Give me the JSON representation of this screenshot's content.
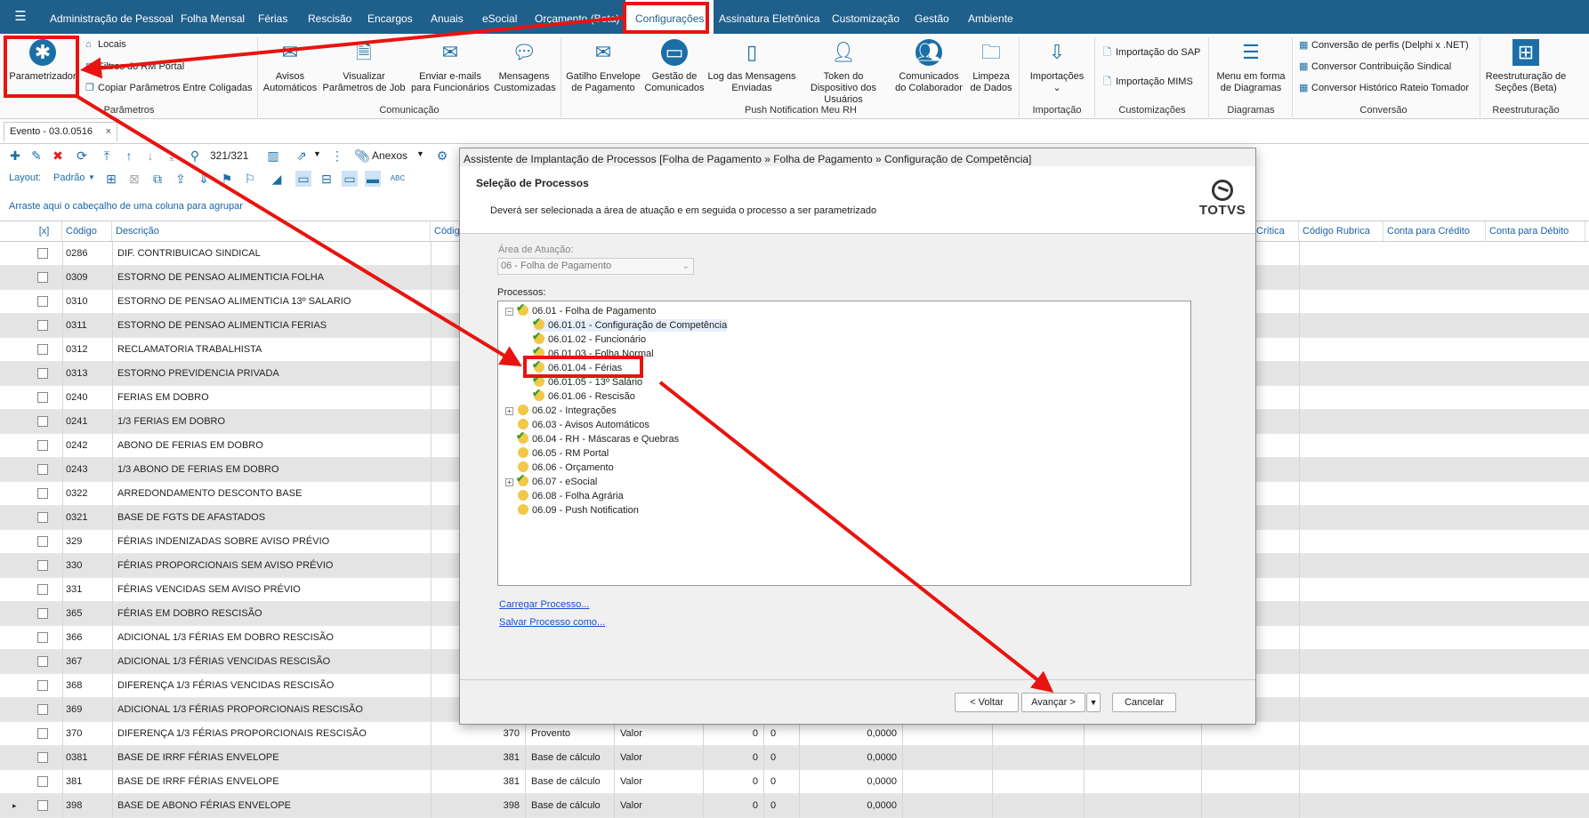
{
  "menubar": {
    "items": [
      "Administração de Pessoal",
      "Folha Mensal",
      "Férias",
      "Rescisão",
      "Encargos",
      "Anuais",
      "eSocial",
      "Orçamento (Beta)",
      "Configurações",
      "Assinatura Eletrônica",
      "Customização",
      "Gestão",
      "Ambiente"
    ],
    "active": "Configurações"
  },
  "ribbon": {
    "parametrizador": "Parametrizador",
    "locais": "Locais",
    "filtros_rm_portal": "Filtros do RM Portal",
    "copiar_parametros": "Copiar Parâmetros Entre Coligadas",
    "group_parametros": "Parâmetros",
    "comunicacao": [
      "Avisos Automáticos",
      "Visualizar Parâmetros de Job",
      "Enviar e-mails para Funcionários",
      "Mensagens Customizadas"
    ],
    "group_comunicacao": "Comunicação",
    "push": [
      "Gatilho Envelope de Pagamento",
      "Gestão de Comunicados",
      "Log das Mensagens Enviadas",
      "Token do Dispositivo dos Usuários",
      "Comunicados do Colaborador",
      "Limpeza de Dados"
    ],
    "group_push": "Push Notification Meu RH",
    "importacoes": "Importações",
    "group_importacao": "Importação",
    "import_sap": "Importação do SAP",
    "import_mims": "Importação MIMS",
    "group_customizacoes": "Customizações",
    "menu_diagramas": "Menu em forma de Diagramas",
    "group_diagramas": "Diagramas",
    "conv_perfis": "Conversão de perfis (Delphi x .NET)",
    "conv_sindical": "Conversor Contribuição Sindical",
    "conv_rateio": "Conversor Histórico Rateio Tomador",
    "group_conversao": "Conversão",
    "reestruturacao": "Reestruturação de Seções (Beta)",
    "group_reestruturacao": "Reestruturação"
  },
  "doctab": {
    "label": "Evento - 03.0.0516",
    "close": "×"
  },
  "toolbar": {
    "count": "321/321",
    "anexos": "Anexos",
    "layout_label": "Layout:",
    "layout_value": "Padrão",
    "group_hint": "Arraste aqui o cabeçalho de uma coluna para agrupar"
  },
  "grid": {
    "headers": {
      "sel": "[x]",
      "codigo": "Código",
      "descricao": "Descrição",
      "codigo2": "Códig",
      "critica": "Crítica",
      "codigo_rubrica": "Código Rubrica",
      "conta_credito": "Conta para Crédito",
      "conta_debito": "Conta para Débito",
      "extra": "C"
    },
    "rows": [
      {
        "codigo": "0286",
        "descricao": "DIF. CONTRIBUICAO SINDICAL"
      },
      {
        "codigo": "0309",
        "descricao": "ESTORNO DE PENSAO ALIMENTICIA FOLHA"
      },
      {
        "codigo": "0310",
        "descricao": "ESTORNO DE PENSAO ALIMENTICIA 13º SALARIO"
      },
      {
        "codigo": "0311",
        "descricao": "ESTORNO DE PENSAO ALIMENTICIA FERIAS"
      },
      {
        "codigo": "0312",
        "descricao": "RECLAMATORIA TRABALHISTA"
      },
      {
        "codigo": "0313",
        "descricao": "ESTORNO PREVIDENCIA PRIVADA"
      },
      {
        "codigo": "0240",
        "descricao": "FERIAS EM DOBRO"
      },
      {
        "codigo": "0241",
        "descricao": "1/3 FERIAS EM DOBRO"
      },
      {
        "codigo": "0242",
        "descricao": "ABONO DE FERIAS EM DOBRO"
      },
      {
        "codigo": "0243",
        "descricao": "1/3 ABONO DE FERIAS EM DOBRO"
      },
      {
        "codigo": "0322",
        "descricao": "ARREDONDAMENTO DESCONTO BASE"
      },
      {
        "codigo": "0321",
        "descricao": "BASE DE FGTS DE AFASTADOS"
      },
      {
        "codigo": "329",
        "descricao": "FÉRIAS INDENIZADAS SOBRE AVISO PRÉVIO"
      },
      {
        "codigo": "330",
        "descricao": "FÉRIAS PROPORCIONAIS SEM AVISO PRÉVIO"
      },
      {
        "codigo": "331",
        "descricao": "FÉRIAS VENCIDAS SEM AVISO PRÉVIO"
      },
      {
        "codigo": "365",
        "descricao": "FÉRIAS EM DOBRO RESCISÃO"
      },
      {
        "codigo": "366",
        "descricao": "ADICIONAL 1/3 FÉRIAS EM DOBRO RESCISÃO"
      },
      {
        "codigo": "367",
        "descricao": "ADICIONAL 1/3 FÉRIAS VENCIDAS RESCISÃO"
      },
      {
        "codigo": "368",
        "descricao": "DIFERENÇA 1/3 FÉRIAS VENCIDAS RESCISÃO"
      },
      {
        "codigo": "369",
        "descricao": "ADICIONAL 1/3 FÉRIAS PROPORCIONAIS RESCISÃO"
      },
      {
        "codigo": "370",
        "descricao": "DIFERENÇA 1/3 FÉRIAS PROPORCIONAIS RESCISÃO",
        "c2": "370",
        "tipo": "Provento",
        "valor": "Valor",
        "n1": "0",
        "n2": "0",
        "n3": "0,0000"
      },
      {
        "codigo": "0381",
        "descricao": "BASE DE IRRF FÉRIAS ENVELOPE",
        "c2": "381",
        "tipo": "Base de cálculo",
        "valor": "Valor",
        "n1": "0",
        "n2": "0",
        "n3": "0,0000"
      },
      {
        "codigo": "381",
        "descricao": "BASE DE IRRF FÉRIAS ENVELOPE",
        "c2": "381",
        "tipo": "Base de cálculo",
        "valor": "Valor",
        "n1": "0",
        "n2": "0",
        "n3": "0,0000"
      },
      {
        "codigo": "398",
        "descricao": "BASE DE ABONO FÉRIAS ENVELOPE",
        "c2": "398",
        "tipo": "Base de cálculo",
        "valor": "Valor",
        "n1": "0",
        "n2": "0",
        "n3": "0,0000"
      }
    ]
  },
  "dialog": {
    "title": "Assistente de Implantação de Processos [Folha de Pagamento » Folha de Pagamento » Configuração de Competência]",
    "heading": "Seleção de Processos",
    "subheading": "Deverá ser selecionada a área de atuação e em seguida o processo a ser parametrizado",
    "brand": "TOTVS",
    "area_label": "Área de Atuação:",
    "area_value": "06 - Folha de Pagamento",
    "processos_label": "Processos:",
    "tree": [
      {
        "label": "06.01 - Folha de Pagamento",
        "level": 0,
        "exp": "−",
        "checked": true
      },
      {
        "label": "06.01.01 - Configuração de Competência",
        "level": 1,
        "checked": true,
        "selected": true
      },
      {
        "label": "06.01.02 - Funcionário",
        "level": 1,
        "checked": true
      },
      {
        "label": "06.01.03 - Folha Normal",
        "level": 1,
        "checked": true
      },
      {
        "label": "06.01.04 - Férias",
        "level": 1,
        "checked": true
      },
      {
        "label": "06.01.05 - 13º Salário",
        "level": 1,
        "checked": true
      },
      {
        "label": "06.01.06 - Rescisão",
        "level": 1,
        "checked": true
      },
      {
        "label": "06.02 - Integrações",
        "level": 0,
        "exp": "+",
        "checked": false
      },
      {
        "label": "06.03 - Avisos Automáticos",
        "level": 0,
        "checked": false
      },
      {
        "label": "06.04 - RH - Máscaras e Quebras",
        "level": 0,
        "checked": true
      },
      {
        "label": "06.05 - RM Portal",
        "level": 0,
        "checked": false
      },
      {
        "label": "06.06 - Orçamento",
        "level": 0,
        "checked": false
      },
      {
        "label": "06.07 - eSocial",
        "level": 0,
        "exp": "+",
        "checked": true
      },
      {
        "label": "06.08 - Folha Agrária",
        "level": 0,
        "checked": false
      },
      {
        "label": "06.09 - Push Notification",
        "level": 0,
        "checked": false
      }
    ],
    "carregar": "Carregar Processo...",
    "salvar": "Salvar Processo como...",
    "voltar": "< Voltar",
    "avancar": "Avançar >",
    "cancelar": "Cancelar"
  },
  "colors": {
    "menubar": "#1f5f8c",
    "accent": "#1c6fa6",
    "annotation": "#e8140f",
    "header_text": "#1a62a6"
  }
}
